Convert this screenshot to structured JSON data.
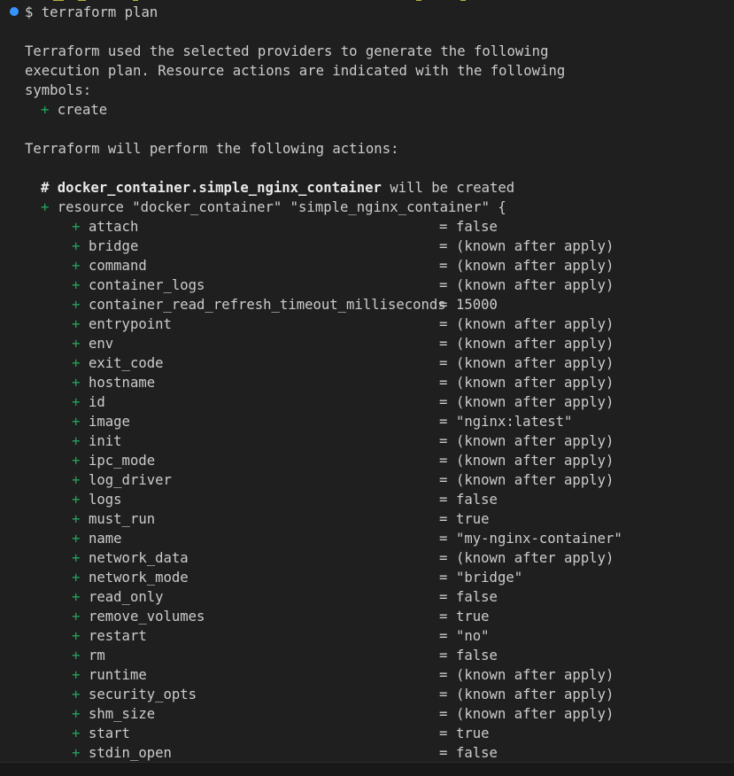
{
  "prompt": {
    "symbol": "$",
    "command": "terraform plan"
  },
  "intro": {
    "line1": "Terraform used the selected providers to generate the following",
    "line2": "execution plan. Resource actions are indicated with the following",
    "line3": "symbols:",
    "symbol_plus": "+",
    "symbol_label": "create"
  },
  "actions_heading": "Terraform will perform the following actions:",
  "resource": {
    "hash": "#",
    "address": "docker_container.simple_nginx_container",
    "suffix": " will be created",
    "plus": "+",
    "declaration": "resource \"docker_container\" \"simple_nginx_container\" {"
  },
  "attributes": [
    {
      "name": "attach",
      "value": "false"
    },
    {
      "name": "bridge",
      "value": "(known after apply)"
    },
    {
      "name": "command",
      "value": "(known after apply)"
    },
    {
      "name": "container_logs",
      "value": "(known after apply)"
    },
    {
      "name": "container_read_refresh_timeout_milliseconds",
      "value": "15000"
    },
    {
      "name": "entrypoint",
      "value": "(known after apply)"
    },
    {
      "name": "env",
      "value": "(known after apply)"
    },
    {
      "name": "exit_code",
      "value": "(known after apply)"
    },
    {
      "name": "hostname",
      "value": "(known after apply)"
    },
    {
      "name": "id",
      "value": "(known after apply)"
    },
    {
      "name": "image",
      "value": "\"nginx:latest\""
    },
    {
      "name": "init",
      "value": "(known after apply)"
    },
    {
      "name": "ipc_mode",
      "value": "(known after apply)"
    },
    {
      "name": "log_driver",
      "value": "(known after apply)"
    },
    {
      "name": "logs",
      "value": "false"
    },
    {
      "name": "must_run",
      "value": "true"
    },
    {
      "name": "name",
      "value": "\"my-nginx-container\""
    },
    {
      "name": "network_data",
      "value": "(known after apply)"
    },
    {
      "name": "network_mode",
      "value": "\"bridge\""
    },
    {
      "name": "read_only",
      "value": "false"
    },
    {
      "name": "remove_volumes",
      "value": "true"
    },
    {
      "name": "restart",
      "value": "\"no\""
    },
    {
      "name": "rm",
      "value": "false"
    },
    {
      "name": "runtime",
      "value": "(known after apply)"
    },
    {
      "name": "security_opts",
      "value": "(known after apply)"
    },
    {
      "name": "shm_size",
      "value": "(known after apply)"
    },
    {
      "name": "start",
      "value": "true"
    },
    {
      "name": "stdin_open",
      "value": "false"
    }
  ],
  "attr_symbol": "+",
  "attr_equals": "=",
  "colors": {
    "background": "#1f1f1f",
    "text": "#cccccc",
    "plus": "#22a35a",
    "decoration": "#3794ff"
  }
}
